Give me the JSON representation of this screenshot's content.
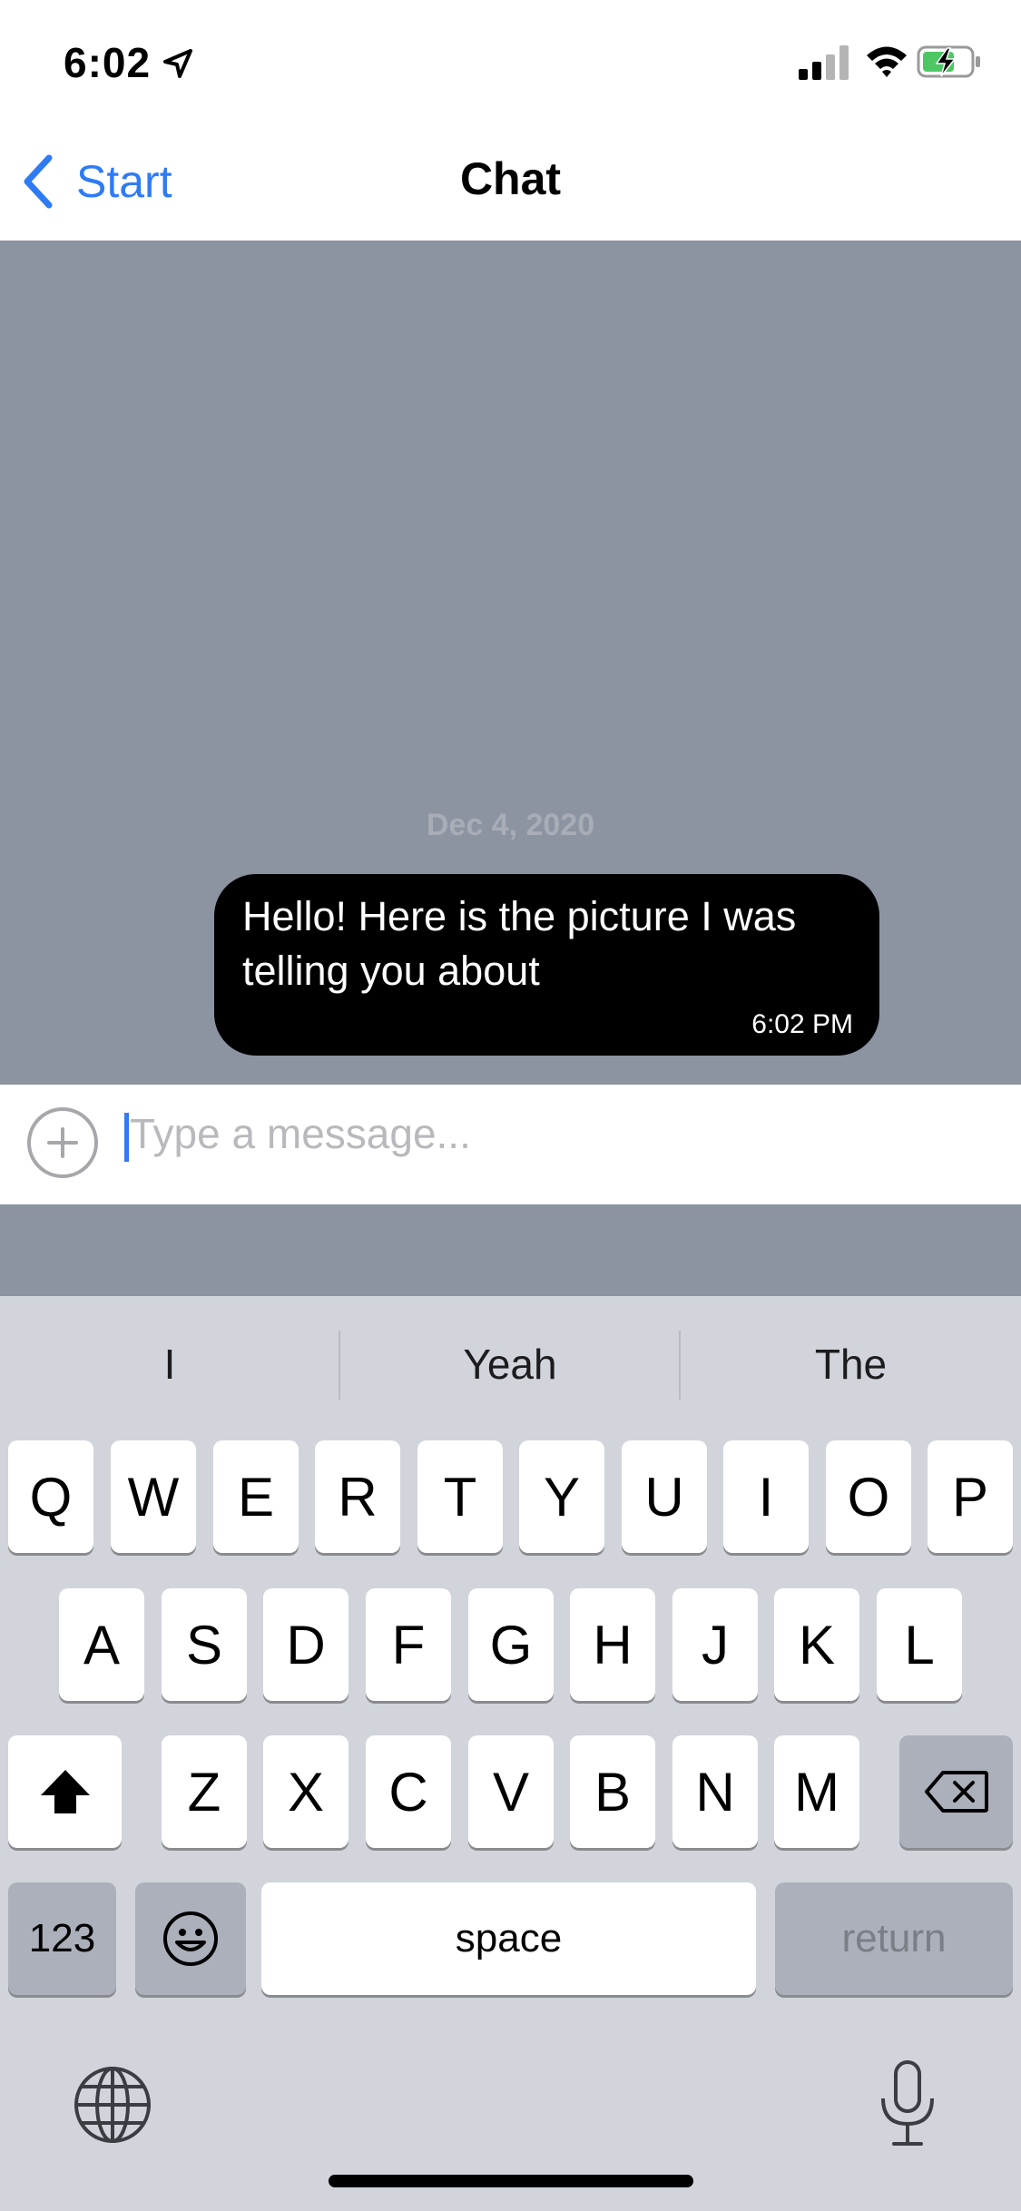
{
  "status_bar": {
    "time": "6:02"
  },
  "nav": {
    "back_label": "Start",
    "title": "Chat"
  },
  "chat": {
    "date_separator": "Dec 4, 2020",
    "messages": [
      {
        "text": "Hello! Here is the picture I was telling you about",
        "time": "6:02 PM"
      }
    ]
  },
  "input": {
    "placeholder": "Type a message..."
  },
  "keyboard": {
    "suggestions": [
      "I",
      "Yeah",
      "The"
    ],
    "row1": [
      "Q",
      "W",
      "E",
      "R",
      "T",
      "Y",
      "U",
      "I",
      "O",
      "P"
    ],
    "row2": [
      "A",
      "S",
      "D",
      "F",
      "G",
      "H",
      "J",
      "K",
      "L"
    ],
    "row3": [
      "Z",
      "X",
      "C",
      "V",
      "B",
      "N",
      "M"
    ],
    "numbers_label": "123",
    "space_label": "space",
    "return_label": "return"
  },
  "colors": {
    "accent": "#2f7bf5",
    "chat_background": "#8c93a1",
    "bubble": "#000000",
    "keyboard_background": "#d1d4db"
  }
}
